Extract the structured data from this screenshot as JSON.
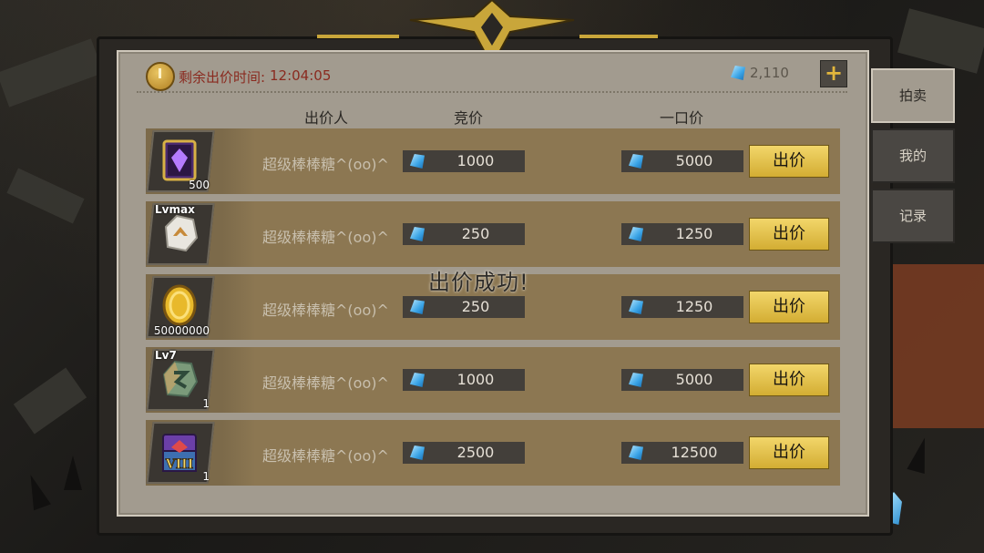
{
  "timer": {
    "label": "剩余出价时间:",
    "value": "12:04:05"
  },
  "balance": "2,110",
  "plus_label": "+",
  "columns": {
    "bidder": "出价人",
    "bid": "竞价",
    "buyout": "一口价"
  },
  "rows": [
    {
      "item": "purple-spellbook",
      "level": "",
      "count": "500",
      "seller": "超级棒棒糖^(oo)^",
      "bid": "1000",
      "buyout": "5000",
      "button": "出价"
    },
    {
      "item": "white-rune-stone",
      "level": "Lvmax",
      "count": "",
      "seller": "超级棒棒糖^(oo)^",
      "bid": "250",
      "buyout": "1250",
      "button": "出价"
    },
    {
      "item": "gold-coin",
      "level": "",
      "count": "50000000",
      "seller": "超级棒棒糖^(oo)^",
      "bid": "250",
      "buyout": "1250",
      "button": "出价"
    },
    {
      "item": "green-rune-stone",
      "level": "Lv7",
      "count": "1",
      "seller": "超级棒棒糖^(oo)^",
      "bid": "1000",
      "buyout": "5000",
      "button": "出价"
    },
    {
      "item": "treasure-chest-viii",
      "level": "",
      "count": "1",
      "seller": "超级棒棒糖^(oo)^",
      "bid": "2500",
      "buyout": "12500",
      "button": "出价"
    }
  ],
  "chest_numeral": "VIII",
  "tabs": [
    {
      "label": "拍卖",
      "active": true
    },
    {
      "label": "我的",
      "active": false
    },
    {
      "label": "记录",
      "active": false
    }
  ],
  "toast": "出价成功!",
  "colors": {
    "panel": "#a29b8f",
    "row": "#8c7752",
    "accent_gold": "#e2b63c",
    "timer_text": "#8a2a1f",
    "gem": "#3aa4e6"
  }
}
